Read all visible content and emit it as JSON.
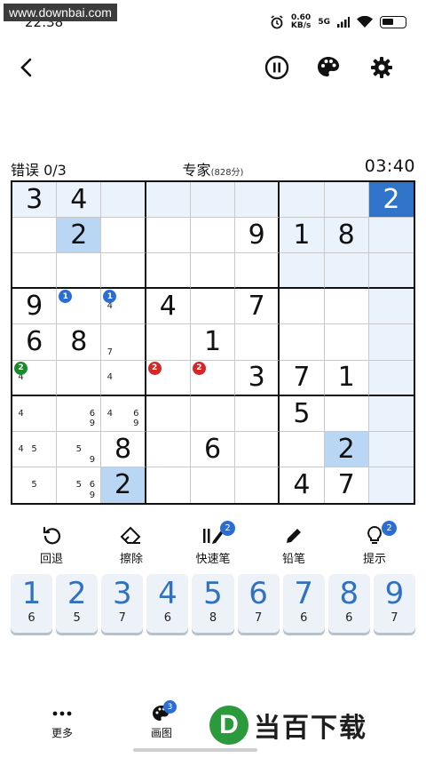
{
  "status": {
    "watermark": "www.downbai.com",
    "time": "22:38",
    "speed": "0.60",
    "speed_unit": "KB/s",
    "network": "5G"
  },
  "info": {
    "mistakes": "错误 0/3",
    "difficulty": "专家",
    "points": "(828分)",
    "timer": "03:40"
  },
  "board": [
    [
      {
        "v": "3",
        "s": "hl"
      },
      {
        "v": "4",
        "s": "hl"
      },
      {
        "v": "",
        "s": "hl"
      },
      {
        "v": "",
        "s": "hl"
      },
      {
        "v": "",
        "s": "hl"
      },
      {
        "v": "",
        "s": "hl"
      },
      {
        "v": "",
        "s": "hl"
      },
      {
        "v": "",
        "s": "hl"
      },
      {
        "v": "2",
        "s": "act"
      }
    ],
    [
      {
        "v": ""
      },
      {
        "v": "2",
        "s": "sel"
      },
      {
        "v": ""
      },
      {
        "v": ""
      },
      {
        "v": ""
      },
      {
        "v": "9"
      },
      {
        "v": "1",
        "s": "hl"
      },
      {
        "v": "8",
        "s": "hl"
      },
      {
        "v": "",
        "s": "hl"
      }
    ],
    [
      {
        "v": ""
      },
      {
        "v": ""
      },
      {
        "v": ""
      },
      {
        "v": ""
      },
      {
        "v": ""
      },
      {
        "v": ""
      },
      {
        "v": "",
        "s": "hl"
      },
      {
        "v": "",
        "s": "hl"
      },
      {
        "v": "",
        "s": "hl"
      }
    ],
    [
      {
        "v": "9"
      },
      {
        "v": "",
        "badge": "1",
        "bc": "blue"
      },
      {
        "v": "",
        "badge": "1",
        "bc": "blue",
        "notes": [
          "",
          "",
          "",
          "4",
          "",
          "",
          "",
          "",
          ""
        ]
      },
      {
        "v": "4"
      },
      {
        "v": ""
      },
      {
        "v": "7"
      },
      {
        "v": ""
      },
      {
        "v": ""
      },
      {
        "v": "",
        "s": "hl"
      }
    ],
    [
      {
        "v": "6"
      },
      {
        "v": "8"
      },
      {
        "v": "",
        "notes": [
          "",
          "",
          "",
          "",
          "",
          "",
          "7",
          "",
          ""
        ]
      },
      {
        "v": ""
      },
      {
        "v": "1"
      },
      {
        "v": ""
      },
      {
        "v": ""
      },
      {
        "v": ""
      },
      {
        "v": "",
        "s": "hl"
      }
    ],
    [
      {
        "v": "",
        "badge": "2",
        "bc": "green",
        "notes": [
          "",
          "",
          "",
          "4",
          "",
          "",
          "",
          "",
          ""
        ]
      },
      {
        "v": ""
      },
      {
        "v": "",
        "notes": [
          "",
          "",
          "",
          "4",
          "",
          "",
          "",
          "",
          ""
        ]
      },
      {
        "v": "",
        "badge": "2",
        "bc": "red"
      },
      {
        "v": "",
        "badge": "2",
        "bc": "red"
      },
      {
        "v": "3"
      },
      {
        "v": "7"
      },
      {
        "v": "1"
      },
      {
        "v": "",
        "s": "hl"
      }
    ],
    [
      {
        "v": "",
        "notes": [
          "",
          "",
          "",
          "4",
          "",
          "",
          "",
          "",
          ""
        ]
      },
      {
        "v": "",
        "notes": [
          "",
          "",
          "",
          "",
          "",
          "6",
          "",
          "",
          "9"
        ]
      },
      {
        "v": "",
        "notes": [
          "",
          "",
          "",
          "4",
          "",
          "6",
          "",
          "",
          "9"
        ]
      },
      {
        "v": ""
      },
      {
        "v": ""
      },
      {
        "v": ""
      },
      {
        "v": "5"
      },
      {
        "v": ""
      },
      {
        "v": "",
        "s": "hl"
      }
    ],
    [
      {
        "v": "",
        "notes": [
          "",
          "",
          "",
          "4",
          "5",
          "",
          "",
          "",
          ""
        ]
      },
      {
        "v": "",
        "notes": [
          "",
          "",
          "",
          "",
          "5",
          "",
          "",
          "",
          "9"
        ]
      },
      {
        "v": "8"
      },
      {
        "v": ""
      },
      {
        "v": "6"
      },
      {
        "v": ""
      },
      {
        "v": ""
      },
      {
        "v": "2",
        "s": "sel"
      },
      {
        "v": "",
        "s": "hl"
      }
    ],
    [
      {
        "v": "",
        "notes": [
          "",
          "",
          "",
          "",
          "5",
          "",
          "",
          "",
          ""
        ]
      },
      {
        "v": "",
        "notes": [
          "",
          "",
          "",
          "",
          "5",
          "6",
          "",
          "",
          "9"
        ]
      },
      {
        "v": "2",
        "s": "sel"
      },
      {
        "v": ""
      },
      {
        "v": ""
      },
      {
        "v": ""
      },
      {
        "v": "4"
      },
      {
        "v": "7"
      },
      {
        "v": "",
        "s": "hl"
      }
    ]
  ],
  "tools": [
    {
      "label": "回退",
      "icon": "undo-icon"
    },
    {
      "label": "擦除",
      "icon": "eraser-icon"
    },
    {
      "label": "快速笔",
      "icon": "quick-pencil-icon",
      "badge": "2"
    },
    {
      "label": "铅笔",
      "icon": "pencil-icon"
    },
    {
      "label": "提示",
      "icon": "hint-bulb-icon",
      "badge": "2"
    }
  ],
  "numpad": [
    {
      "digit": "1",
      "count": "6"
    },
    {
      "digit": "2",
      "count": "5"
    },
    {
      "digit": "3",
      "count": "7"
    },
    {
      "digit": "4",
      "count": "6"
    },
    {
      "digit": "5",
      "count": "8"
    },
    {
      "digit": "6",
      "count": "7"
    },
    {
      "digit": "7",
      "count": "6"
    },
    {
      "digit": "8",
      "count": "6"
    },
    {
      "digit": "9",
      "count": "7"
    }
  ],
  "bottom": {
    "more": "更多",
    "paint": "画图",
    "paint_badge": "3"
  },
  "logo": {
    "mark": "D",
    "text": "当百下载"
  },
  "colors": {
    "accent": "#2f74c9",
    "highlight": "#eaf3fc",
    "selected": "#b9d7f5"
  }
}
